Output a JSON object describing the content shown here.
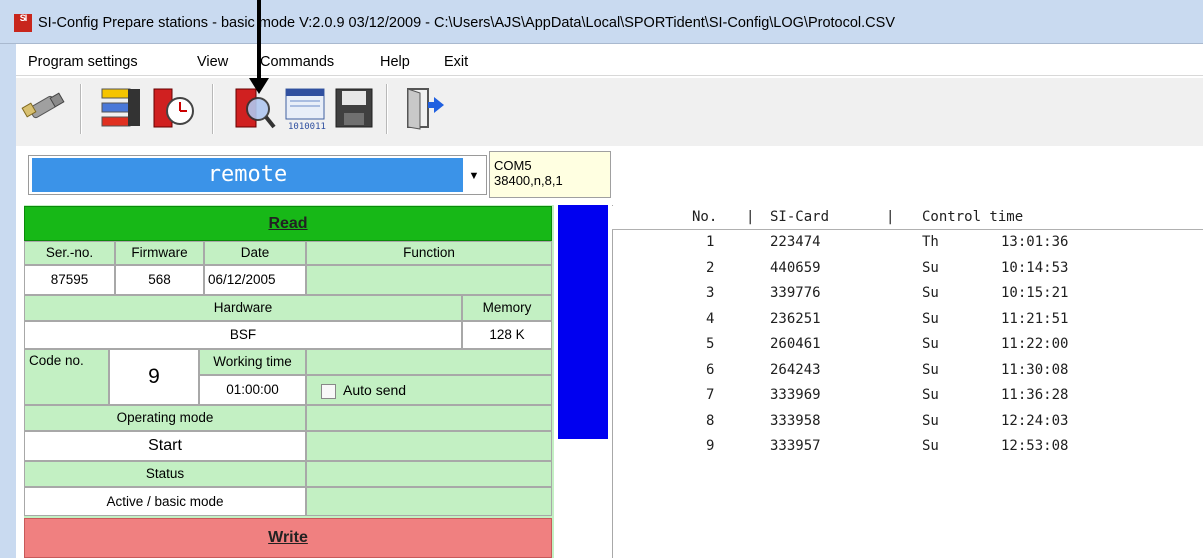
{
  "window": {
    "title": "SI-Config Prepare stations - basic mode V:2.0.9 03/12/2009 - C:\\Users\\AJS\\AppData\\Local\\SPORTident\\SI-Config\\LOG\\Protocol.CSV",
    "icon_text": "SI"
  },
  "menu": {
    "items": [
      "Program settings",
      "View",
      "Commands",
      "Help",
      "Exit"
    ]
  },
  "toolbar": {
    "buttons": [
      "connect-icon",
      "stations-icon",
      "clock-station-icon",
      "readout-station-icon",
      "backup-memory-icon",
      "save-icon",
      "exit-icon"
    ]
  },
  "station": {
    "mode_value": "remote",
    "port": "COM5",
    "port_settings": "38400,n,8,1"
  },
  "panel": {
    "read_label": "Read",
    "write_label": "Write",
    "headers": {
      "serial": "Ser.-no.",
      "firmware": "Firmware",
      "date": "Date",
      "function": "Function",
      "hardware": "Hardware",
      "memory": "Memory",
      "code_no": "Code no.",
      "working_time": "Working time",
      "operating_mode": "Operating mode",
      "status": "Status"
    },
    "values": {
      "serial": "87595",
      "firmware": "568",
      "date": "06/12/2005",
      "function": "",
      "hardware": "BSF",
      "memory": "128 K",
      "code_no": "9",
      "working_time": "01:00:00",
      "auto_send_label": "Auto send",
      "operating_mode": "Start",
      "status": "Active / basic mode"
    }
  },
  "punch_list": {
    "headers": {
      "no": "No.",
      "card": "SI-Card",
      "time": "Control time",
      "sep1": "|",
      "sep2": "|"
    },
    "rows": [
      {
        "no": "1",
        "card": "223474",
        "day": "Th",
        "time": "13:01:36"
      },
      {
        "no": "2",
        "card": "440659",
        "day": "Su",
        "time": "10:14:53"
      },
      {
        "no": "3",
        "card": "339776",
        "day": "Su",
        "time": "10:15:21"
      },
      {
        "no": "4",
        "card": "236251",
        "day": "Su",
        "time": "11:21:51"
      },
      {
        "no": "5",
        "card": "260461",
        "day": "Su",
        "time": "11:22:00"
      },
      {
        "no": "6",
        "card": "264243",
        "day": "Su",
        "time": "11:30:08"
      },
      {
        "no": "7",
        "card": "333969",
        "day": "Su",
        "time": "11:36:28"
      },
      {
        "no": "8",
        "card": "333958",
        "day": "Su",
        "time": "12:24:03"
      },
      {
        "no": "9",
        "card": "333957",
        "day": "Su",
        "time": "12:53:08"
      }
    ]
  },
  "colors": {
    "read_button": "#17b817",
    "write_button": "#f08080",
    "panel_green": "#c3f0c3",
    "remote_field": "#3b93e8",
    "blue_bar": "#0000f0"
  }
}
